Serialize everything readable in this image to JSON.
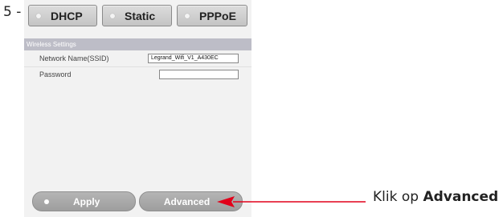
{
  "step_label": "5 -",
  "modes": [
    {
      "label": "DHCP"
    },
    {
      "label": "Static"
    },
    {
      "label": "PPPoE"
    }
  ],
  "wireless": {
    "section_title": "Wireless Settings",
    "ssid_label": "Network Name(SSID)",
    "ssid_value": "Legrand_Wifi_V1_A430EC",
    "password_label": "Password",
    "password_value": ""
  },
  "actions": {
    "apply_label": "Apply",
    "advanced_label": "Advanced"
  },
  "callout": {
    "prefix": "Klik op ",
    "emphasis": "Advanced",
    "color": "#e2001a"
  }
}
